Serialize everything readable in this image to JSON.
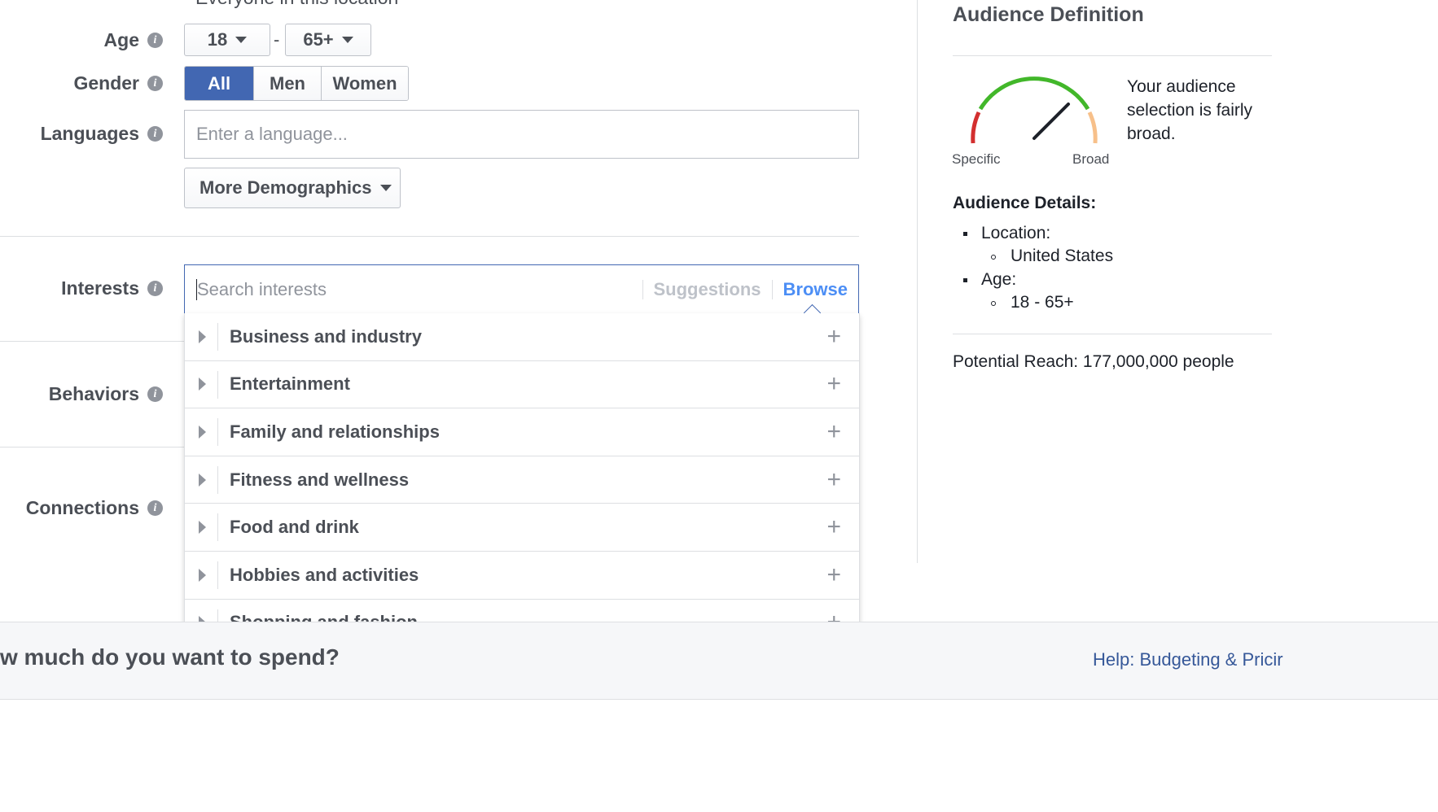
{
  "location_clipped": "Everyone in this location",
  "labels": {
    "age": "Age",
    "gender": "Gender",
    "languages": "Languages",
    "interests": "Interests",
    "behaviors": "Behaviors",
    "connections": "Connections"
  },
  "age": {
    "min": "18",
    "separator": "-",
    "max": "65+"
  },
  "gender": {
    "options": [
      "All",
      "Men",
      "Women"
    ],
    "selected": "All"
  },
  "languages": {
    "placeholder": "Enter a language..."
  },
  "more_demographics": "More Demographics",
  "interests": {
    "placeholder": "Search interests",
    "suggestions": "Suggestions",
    "browse": "Browse",
    "categories": [
      "Business and industry",
      "Entertainment",
      "Family and relationships",
      "Fitness and wellness",
      "Food and drink",
      "Hobbies and activities",
      "Shopping and fashion"
    ]
  },
  "bottom": {
    "spend_question": "w much do you want to spend?",
    "help_link": "Help: Budgeting & Pricir"
  },
  "audience": {
    "title": "Audience Definition",
    "gauge_text": "Your audience selection is fairly broad.",
    "gauge_specific": "Specific",
    "gauge_broad": "Broad",
    "details_title": "Audience Details:",
    "location_label": "Location:",
    "location_value": "United States",
    "age_label": "Age:",
    "age_value": "18 - 65+",
    "reach": "Potential Reach: 177,000,000 people"
  },
  "icons": {
    "info": "info-icon",
    "caret": "caret-down-icon",
    "expand": "triangle-right-icon",
    "add": "plus-icon"
  },
  "colors": {
    "primary_blue": "#4267b2",
    "browse_blue": "#4c8ef5",
    "link_blue": "#365899",
    "gauge_green": "#42b72a",
    "gauge_red": "#d32f2f",
    "gauge_orange": "#f7c08a"
  }
}
